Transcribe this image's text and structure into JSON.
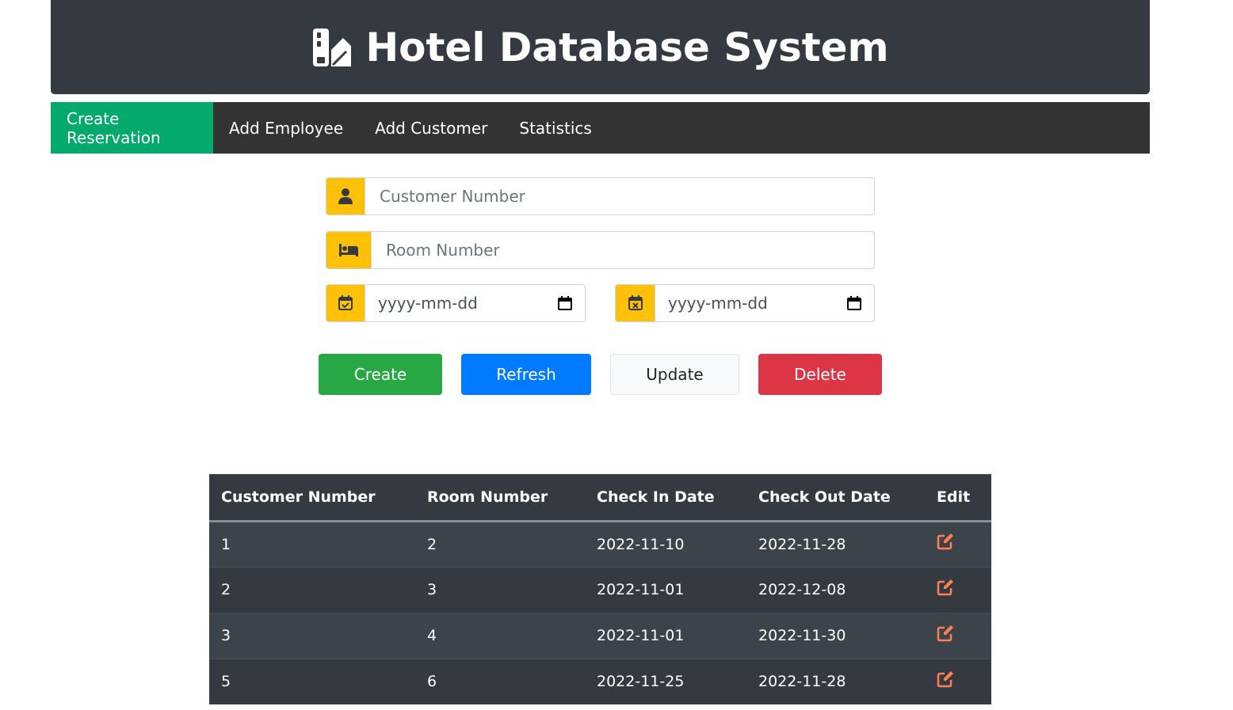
{
  "header": {
    "title": "Hotel Database System",
    "icon": "hotel-icon"
  },
  "nav": {
    "items": [
      {
        "label": "Create Reservation",
        "active": true
      },
      {
        "label": "Add Employee",
        "active": false
      },
      {
        "label": "Add Customer",
        "active": false
      },
      {
        "label": "Statistics",
        "active": false
      }
    ]
  },
  "form": {
    "customer_number": {
      "placeholder": "Customer Number",
      "icon": "user-icon"
    },
    "room_number": {
      "placeholder": "Room Number",
      "icon": "bed-icon"
    },
    "check_in": {
      "placeholder": "yyyy-mm-dd",
      "icon": "calendar-check-icon"
    },
    "check_out": {
      "placeholder": "yyyy-mm-dd",
      "icon": "calendar-x-icon"
    }
  },
  "buttons": {
    "create": "Create",
    "refresh": "Refresh",
    "update": "Update",
    "delete": "Delete"
  },
  "colors": {
    "header_bg": "#343a40",
    "nav_bg": "#333333",
    "nav_active": "#04aa6d",
    "icon_bg": "#ffc107",
    "create": "#28a745",
    "refresh": "#007bff",
    "update": "#f8f9fa",
    "delete": "#dc3545",
    "edit_icon": "#ff7f50"
  },
  "table": {
    "headers": [
      "Customer Number",
      "Room Number",
      "Check In Date",
      "Check Out Date",
      "Edit"
    ],
    "rows": [
      [
        "1",
        "2",
        "2022-11-10",
        "2022-11-28"
      ],
      [
        "2",
        "3",
        "2022-11-01",
        "2022-12-08"
      ],
      [
        "3",
        "4",
        "2022-11-01",
        "2022-11-30"
      ],
      [
        "5",
        "6",
        "2022-11-25",
        "2022-11-28"
      ]
    ]
  }
}
